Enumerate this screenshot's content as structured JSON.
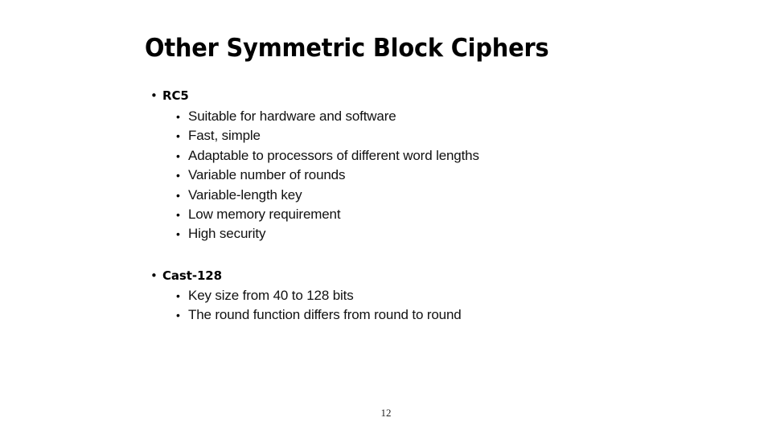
{
  "slide": {
    "title": "Other Symmetric Block Ciphers",
    "page_number": "12",
    "bullet_glyph": "•",
    "background_color": "#ffffff",
    "text_color": "#000000",
    "groups": [
      {
        "heading": "RC5",
        "items": [
          "Suitable for hardware and software",
          "Fast, simple",
          "Adaptable to processors of different word lengths",
          "Variable number of rounds",
          "Variable-length key",
          "Low memory requirement",
          "High security"
        ]
      },
      {
        "heading": "Cast-128",
        "items": [
          "Key size from 40 to 128 bits",
          "The round function differs from round to round"
        ]
      }
    ]
  }
}
